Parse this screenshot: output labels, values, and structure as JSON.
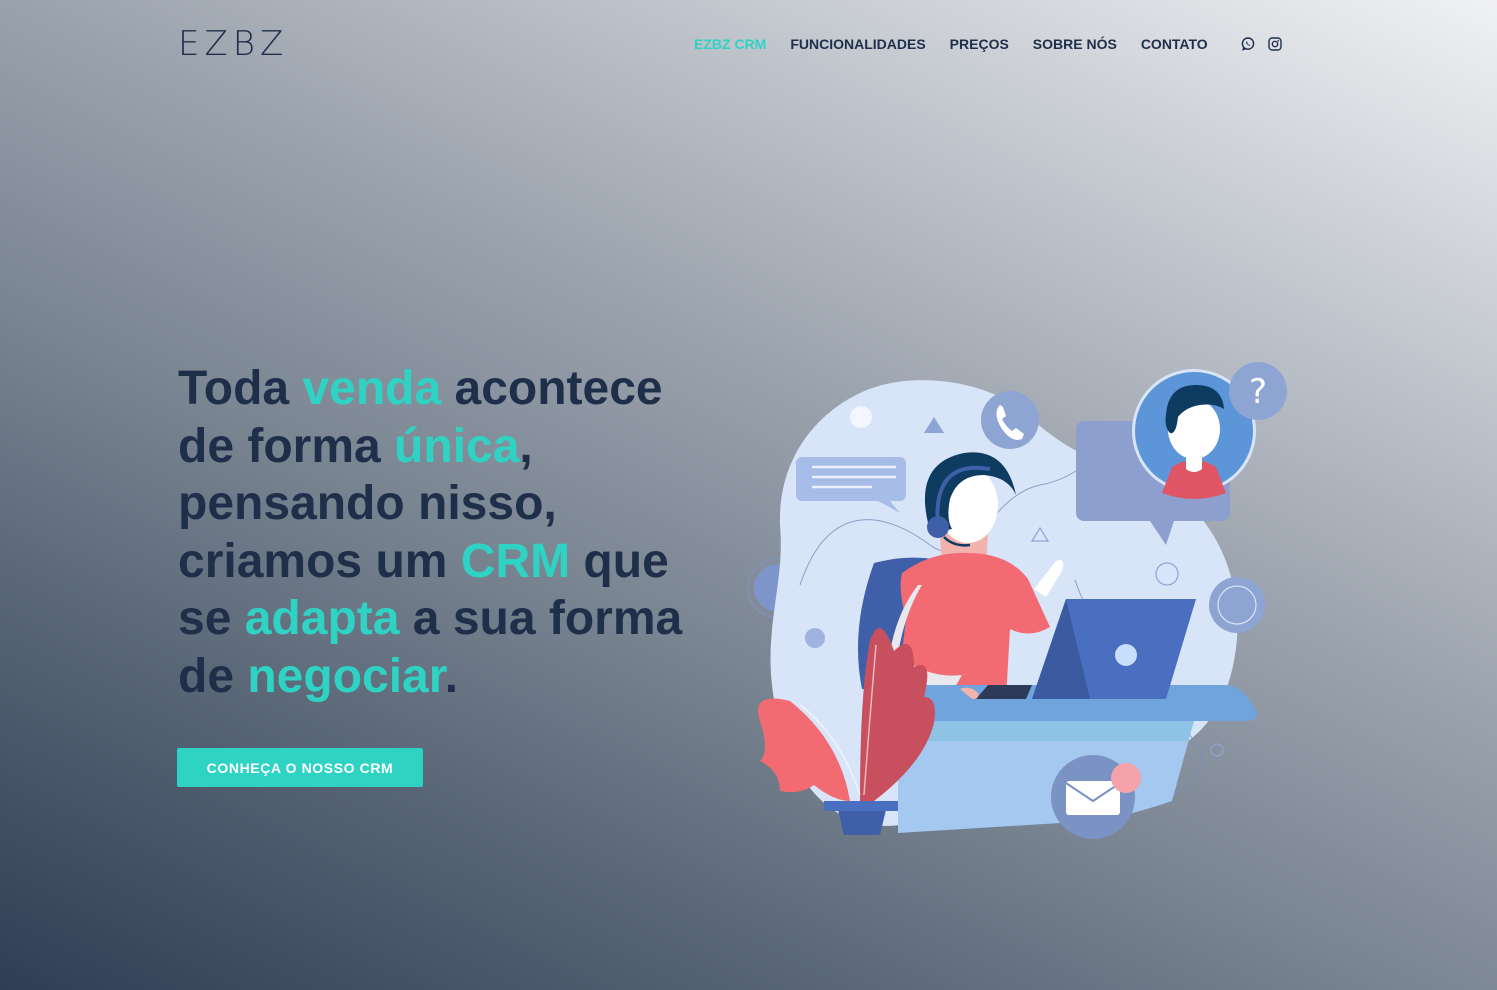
{
  "header": {
    "logo": "EZBZ",
    "nav": [
      {
        "label": "EZBZ CRM",
        "active": true
      },
      {
        "label": "FUNCIONALIDADES",
        "active": false
      },
      {
        "label": "PREÇOS",
        "active": false
      },
      {
        "label": "SOBRE NÓS",
        "active": false
      },
      {
        "label": "CONTATO",
        "active": false
      }
    ],
    "social": [
      "whatsapp-icon",
      "instagram-icon"
    ]
  },
  "hero": {
    "title_parts": [
      {
        "text": "Toda ",
        "highlight": false
      },
      {
        "text": "venda",
        "highlight": true
      },
      {
        "text": " acontece de forma ",
        "highlight": false
      },
      {
        "text": "única",
        "highlight": true
      },
      {
        "text": ", pensando nisso, criamos um ",
        "highlight": false
      },
      {
        "text": "CRM",
        "highlight": true
      },
      {
        "text": " que se ",
        "highlight": false
      },
      {
        "text": "adapta",
        "highlight": true
      },
      {
        "text": " a sua forma de ",
        "highlight": false
      },
      {
        "text": "negociar",
        "highlight": true
      },
      {
        "text": ".",
        "highlight": false
      }
    ],
    "cta_label": "CONHEÇA O NOSSO CRM",
    "illustration": "customer-support-illustration"
  },
  "colors": {
    "accent": "#2ed3c4",
    "text_dark": "#1f2f49",
    "shirt": "#f26b73",
    "laptop": "#4a6fc0"
  }
}
